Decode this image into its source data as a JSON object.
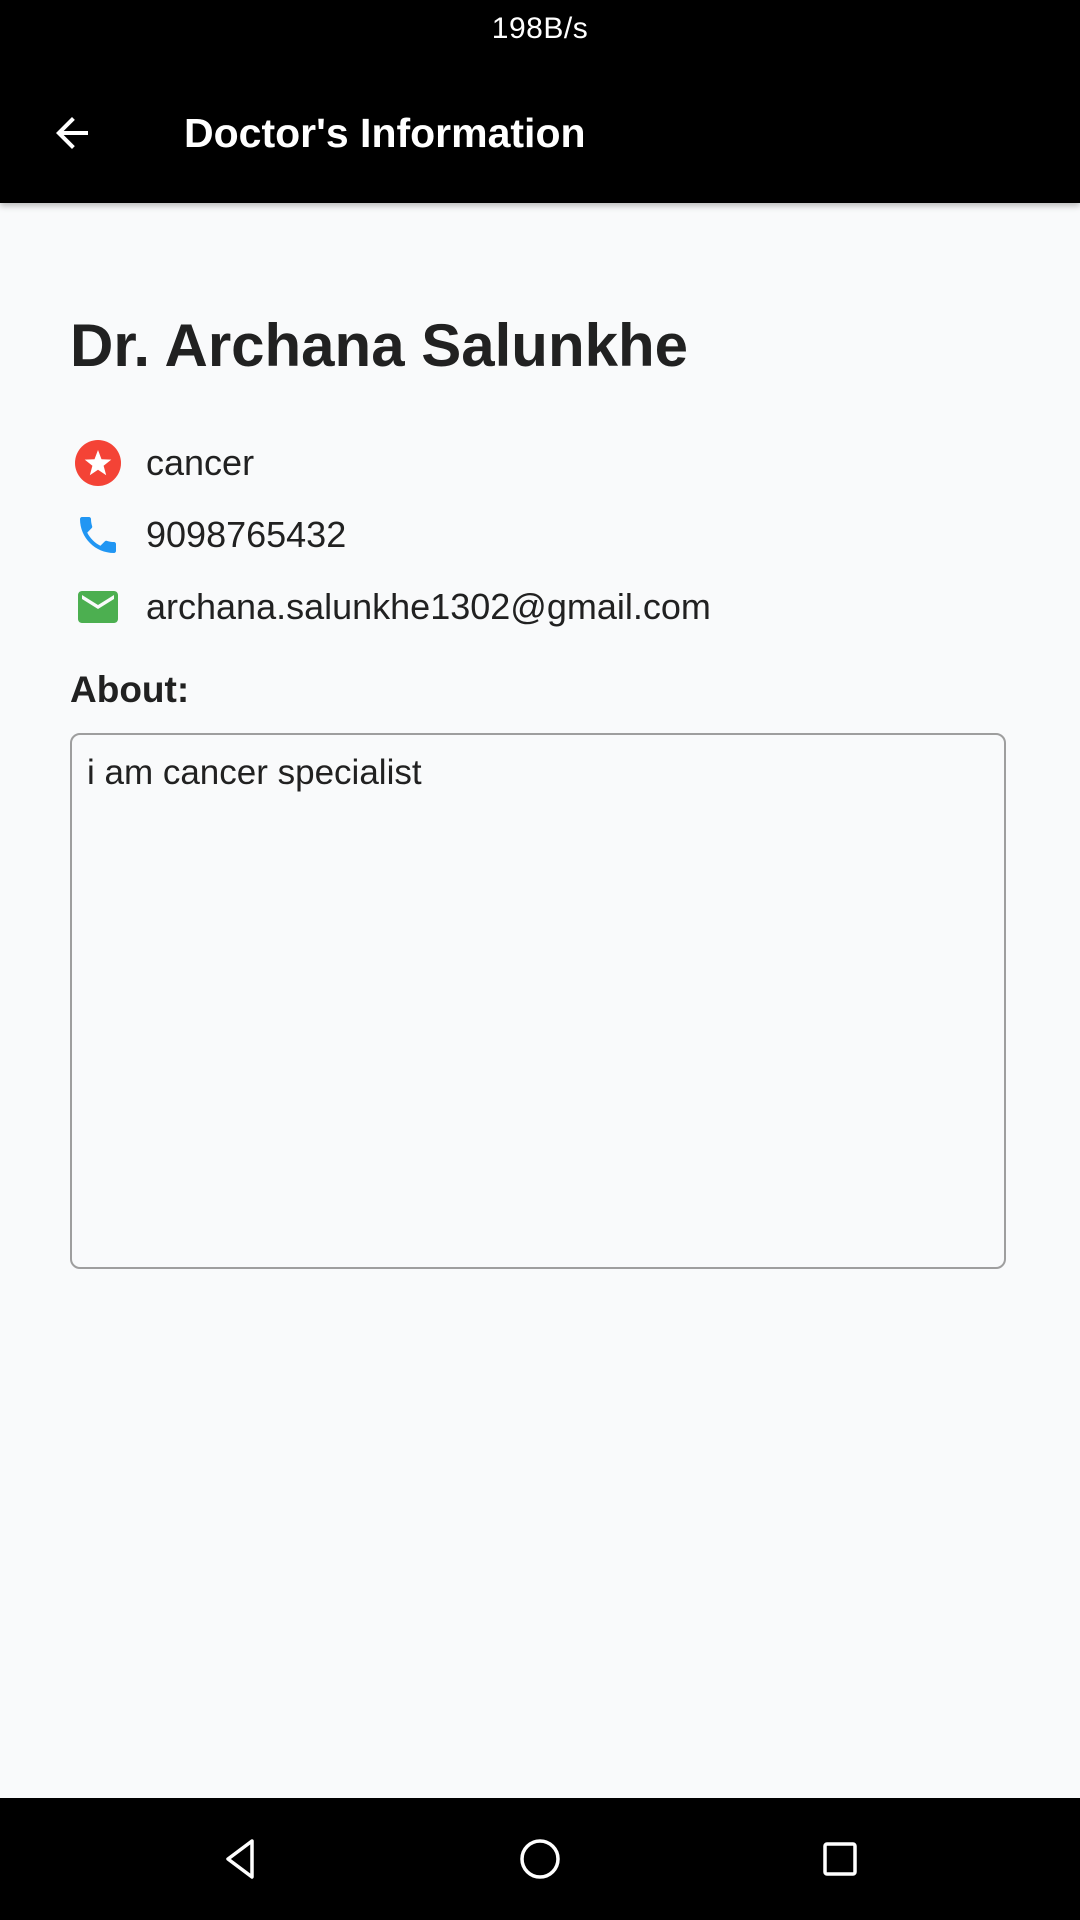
{
  "status_bar": {
    "network_speed": "198B/s"
  },
  "app_bar": {
    "title": "Doctor's Information",
    "back_icon": "arrow-back-icon"
  },
  "doctor": {
    "name": "Dr. Archana Salunkhe",
    "specialty": "cancer",
    "phone": "9098765432",
    "email": "archana.salunkhe1302@gmail.com",
    "about_label": "About:",
    "about_text": "i am cancer specialist"
  },
  "icons": {
    "specialty": "star-badge-icon",
    "phone": "phone-icon",
    "email": "email-icon"
  },
  "colors": {
    "specialty_icon": "#f44336",
    "phone_icon": "#2196f3",
    "email_icon": "#4caf50",
    "app_bar": "#000000",
    "background": "#f9fafb"
  },
  "nav_bar": {
    "back_icon": "nav-back-icon",
    "home_icon": "nav-home-icon",
    "recents_icon": "nav-recents-icon"
  }
}
